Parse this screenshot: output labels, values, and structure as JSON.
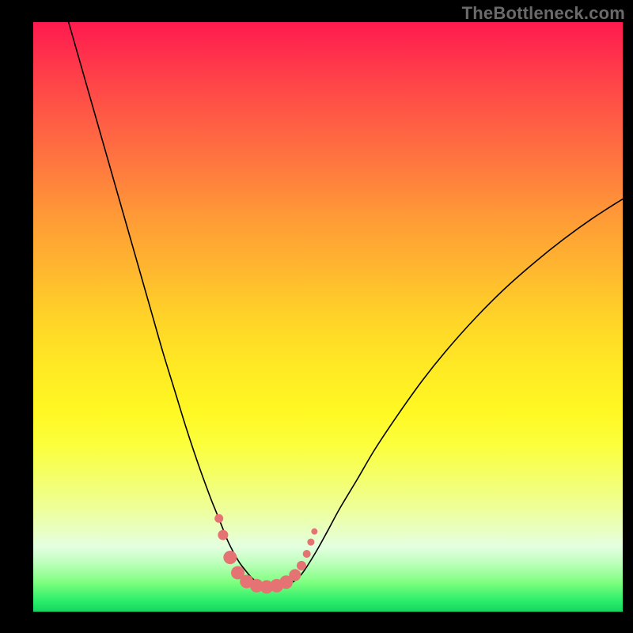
{
  "watermark": "TheBottleneck.com",
  "colors": {
    "background": "#000000",
    "curve": "#000000",
    "point_fill": "#e57373",
    "point_stroke": "#c94f4f"
  },
  "chart_data": {
    "type": "line",
    "title": "",
    "xlabel": "",
    "ylabel": "",
    "xlim": [
      0,
      100
    ],
    "ylim": [
      0,
      100
    ],
    "grid": false,
    "legend": false,
    "series": [
      {
        "name": "bottleneck-curve",
        "x": [
          6,
          8,
          10,
          12,
          14,
          16,
          18,
          20,
          22,
          24,
          26,
          28,
          30,
          31,
          32,
          33,
          34,
          35,
          36,
          37,
          38,
          39,
          40,
          41,
          42,
          43,
          44,
          45,
          46,
          48,
          50,
          52,
          55,
          58,
          62,
          66,
          70,
          75,
          80,
          85,
          90,
          95,
          100
        ],
        "y": [
          100,
          93,
          86,
          79,
          72,
          65,
          58,
          51,
          44,
          37.5,
          31,
          25,
          19.5,
          17,
          14.5,
          12,
          10,
          8.3,
          7,
          5.8,
          5,
          4.5,
          4.2,
          4.1,
          4.2,
          4.5,
          5,
          5.8,
          7,
          10.2,
          13.8,
          17.5,
          22.5,
          27.6,
          33.6,
          39.2,
          44.2,
          49.8,
          54.8,
          59.2,
          63.2,
          66.8,
          70
        ]
      }
    ],
    "points": {
      "name": "sample-points",
      "x": [
        31.5,
        32.2,
        33.4,
        34.7,
        36.2,
        37.9,
        39.6,
        41.3,
        42.9,
        44.4,
        45.5,
        46.4,
        47.1,
        47.7
      ],
      "y": [
        15.8,
        13.0,
        9.2,
        6.6,
        5.1,
        4.4,
        4.2,
        4.4,
        5.0,
        6.2,
        7.8,
        9.8,
        11.8,
        13.6
      ],
      "radius": [
        5.5,
        6.5,
        8.5,
        8.5,
        8.5,
        8.5,
        8.5,
        8.5,
        8.5,
        7.5,
        6.0,
        5.0,
        4.5,
        4.0
      ]
    }
  }
}
